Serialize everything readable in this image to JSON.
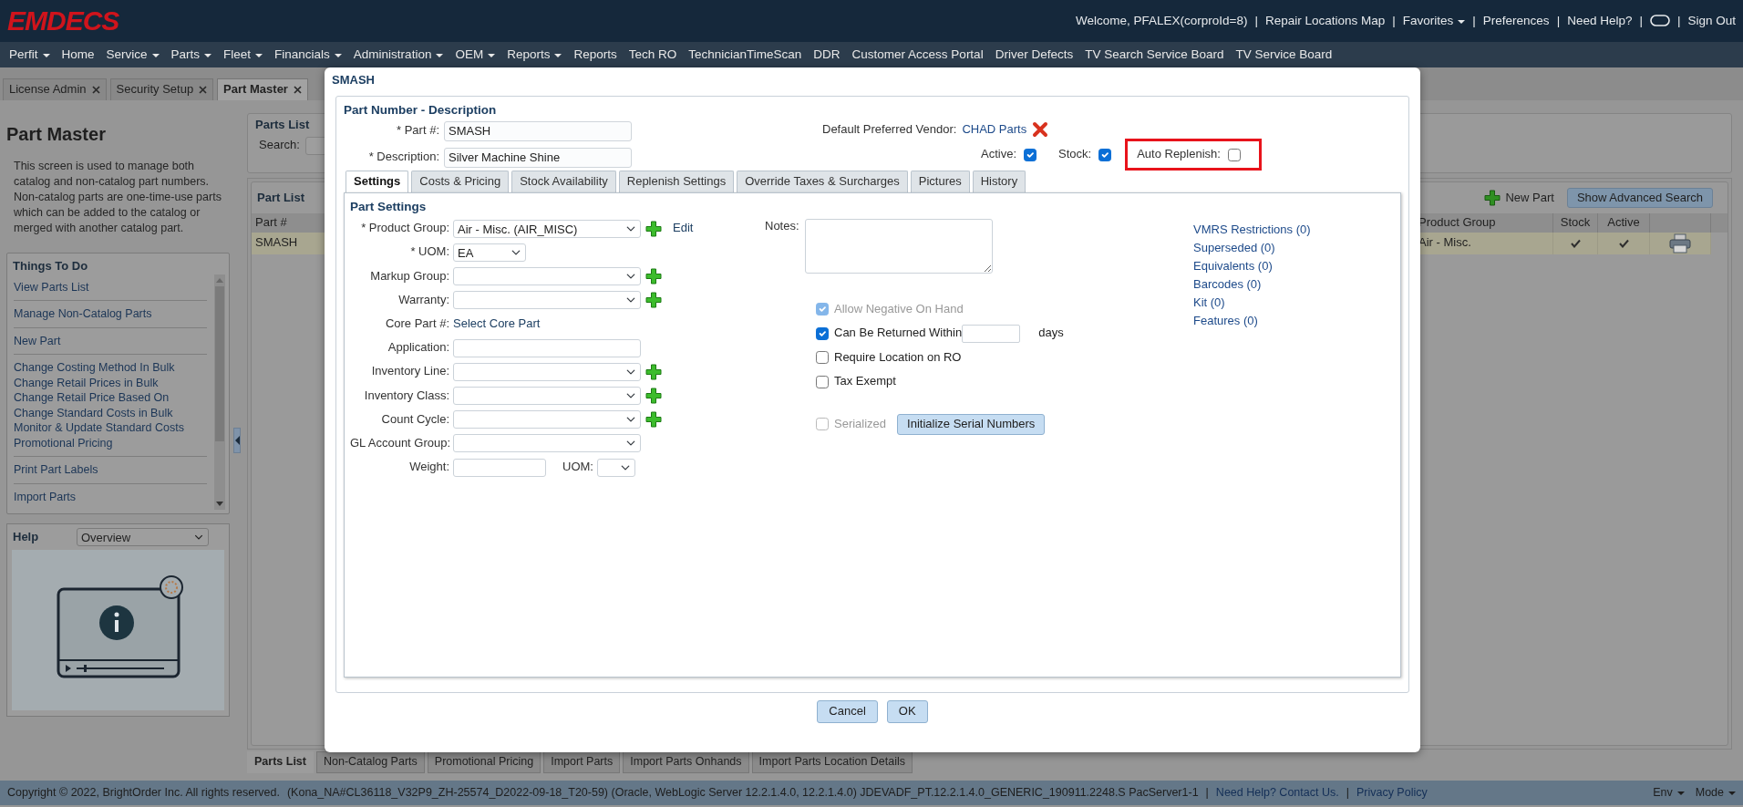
{
  "header": {
    "logo": "EMDECS",
    "separator": "|",
    "items": [
      {
        "kind": "text",
        "label": "Welcome, PFALEX(corproId=8)"
      },
      {
        "kind": "link",
        "label": "Repair Locations Map"
      },
      {
        "kind": "menu",
        "label": "Favorites"
      },
      {
        "kind": "link",
        "label": "Preferences"
      },
      {
        "kind": "link",
        "label": "Need Help?"
      },
      {
        "kind": "icon"
      },
      {
        "kind": "link",
        "label": "Sign Out"
      }
    ]
  },
  "menu": [
    {
      "label": "Perfit",
      "dropdown": true
    },
    {
      "label": "Home",
      "dropdown": false
    },
    {
      "label": "Service",
      "dropdown": true
    },
    {
      "label": "Parts",
      "dropdown": true
    },
    {
      "label": "Fleet",
      "dropdown": true
    },
    {
      "label": "Financials",
      "dropdown": true
    },
    {
      "label": "Administration",
      "dropdown": true
    },
    {
      "label": "OEM",
      "dropdown": true
    },
    {
      "label": "Reports",
      "dropdown": true
    },
    {
      "label": "Reports",
      "dropdown": false
    },
    {
      "label": "Tech RO",
      "dropdown": false
    },
    {
      "label": "TechnicianTimeScan",
      "dropdown": false
    },
    {
      "label": "DDR",
      "dropdown": false
    },
    {
      "label": "Customer Access Portal",
      "dropdown": false
    },
    {
      "label": "Driver Defects",
      "dropdown": false
    },
    {
      "label": "TV Search Service Board",
      "dropdown": false
    },
    {
      "label": "TV Service Board",
      "dropdown": false
    }
  ],
  "page_tabs": [
    {
      "label": "License Admin",
      "selected": false
    },
    {
      "label": "Security Setup",
      "selected": false
    },
    {
      "label": "Part Master",
      "selected": true
    }
  ],
  "sidebar": {
    "title": "Part Master",
    "description": "This screen is used to manage both catalog and non-catalog part numbers. Non-catalog parts are one-time-use parts which can be added to the catalog or merged with another catalog part.",
    "things_to_do": {
      "title": "Things To Do",
      "groups": [
        [
          "View Parts List"
        ],
        [
          "Manage Non-Catalog Parts"
        ],
        [
          "New Part"
        ],
        [
          "Change Costing Method In Bulk",
          "Change Retail Prices in Bulk",
          "Change Retail Price Based On",
          "Change Standard Costs in Bulk",
          "Monitor & Update Standard Costs",
          "Promotional Pricing"
        ],
        [
          "Print Part Labels"
        ],
        [
          "Import Parts"
        ]
      ]
    },
    "help": {
      "title": "Help",
      "select": "Overview"
    }
  },
  "parts_list": {
    "title": "Parts List",
    "search_label": "Search:",
    "grid_title": "Part List",
    "new_part": "New Part",
    "advanced_search": "Show Advanced Search",
    "columns": [
      "Part #",
      "Product Group",
      "Stock",
      "Active"
    ],
    "rows": [
      {
        "part": "SMASH",
        "product_group": "Air - Misc.",
        "stock": true,
        "active": true,
        "selected": true
      }
    ]
  },
  "bottom_tabs": [
    {
      "label": "Parts List",
      "selected": true
    },
    {
      "label": "Non-Catalog Parts",
      "selected": false
    },
    {
      "label": "Promotional Pricing",
      "selected": false
    },
    {
      "label": "Import Parts",
      "selected": false
    },
    {
      "label": "Import Parts Onhands",
      "selected": false
    },
    {
      "label": "Import Parts Location Details",
      "selected": false
    }
  ],
  "footer": {
    "copyright": "Copyright © 2022, BrightOrder Inc. All rights reserved.",
    "version": "(Kona_NA#CL36118_V32P9_ZH-25574_D2022-09-18_T20-59) (Oracle, WebLogic Server 12.2.1.4.0, 12.2.1.4.0) JDEVADF_PT.12.2.1.4.0_GENERIC_190911.2248.S PacServer1-1",
    "separator": "|",
    "links": [
      "Need Help? Contact Us.",
      "Privacy Policy"
    ],
    "menus": [
      "Env",
      "Mode"
    ]
  },
  "dialog": {
    "title": "SMASH",
    "section_title": "Part Number - Description",
    "part_no": {
      "label": "* Part #:",
      "value": "SMASH"
    },
    "description": {
      "label": "* Description:",
      "value": "Silver Machine Shine"
    },
    "vendor": {
      "label": "Default Preferred Vendor:",
      "value": "CHAD Parts"
    },
    "flags": [
      {
        "label": "Active:",
        "checked": true,
        "highlighted": false
      },
      {
        "label": "Stock:",
        "checked": true,
        "highlighted": false
      },
      {
        "label": "Auto Replenish:",
        "checked": false,
        "highlighted": true
      }
    ],
    "tabs": [
      {
        "label": "Settings",
        "selected": true
      },
      {
        "label": "Costs & Pricing",
        "selected": false
      },
      {
        "label": "Stock Availability",
        "selected": false
      },
      {
        "label": "Replenish Settings",
        "selected": false
      },
      {
        "label": "Override Taxes & Surcharges",
        "selected": false
      },
      {
        "label": "Pictures",
        "selected": false
      },
      {
        "label": "History",
        "selected": false
      }
    ],
    "settings_title": "Part Settings",
    "fields": [
      {
        "kind": "select",
        "label": "* Product Group:",
        "value": "Air - Misc. (AIR_MISC)",
        "add": true,
        "link": "Edit"
      },
      {
        "kind": "small_select",
        "label": "* UOM:",
        "value": "EA",
        "add": false
      },
      {
        "kind": "select",
        "label": "Markup Group:",
        "add": true
      },
      {
        "kind": "select",
        "label": "Warranty:",
        "add": true
      },
      {
        "kind": "link",
        "label": "Core Part #:",
        "value": "Select Core Part",
        "add": false
      },
      {
        "kind": "text",
        "label": "Application:",
        "add": false
      },
      {
        "kind": "select",
        "label": "Inventory Line:",
        "add": true
      },
      {
        "kind": "select",
        "label": "Inventory Class:",
        "add": true
      },
      {
        "kind": "select",
        "label": "Count Cycle:",
        "add": true
      },
      {
        "kind": "select",
        "label": "GL Account Group:",
        "add": false
      },
      {
        "kind": "measure",
        "label": "Weight:",
        "unit_label": "UOM:",
        "add": false
      }
    ],
    "notes_label": "Notes:",
    "options": [
      {
        "label": "Allow Negative On Hand",
        "checked": true,
        "disabled": true
      },
      {
        "label": "Can Be Returned Within",
        "checked": true,
        "disabled": false,
        "suffix": "days"
      },
      {
        "label": "Require Location on RO",
        "checked": false,
        "disabled": false
      },
      {
        "label": "Tax Exempt",
        "checked": false,
        "disabled": false
      }
    ],
    "serialized": {
      "label": "Serialized",
      "checked": false,
      "disabled": true,
      "button": "Initialize Serial Numbers"
    },
    "related_links": [
      "VMRS Restrictions (0)",
      "Superseded (0)",
      "Equivalents (0)",
      "Barcodes (0)",
      "Kit (0)",
      "Features (0)"
    ],
    "buttons": [
      "Cancel",
      "OK"
    ]
  }
}
